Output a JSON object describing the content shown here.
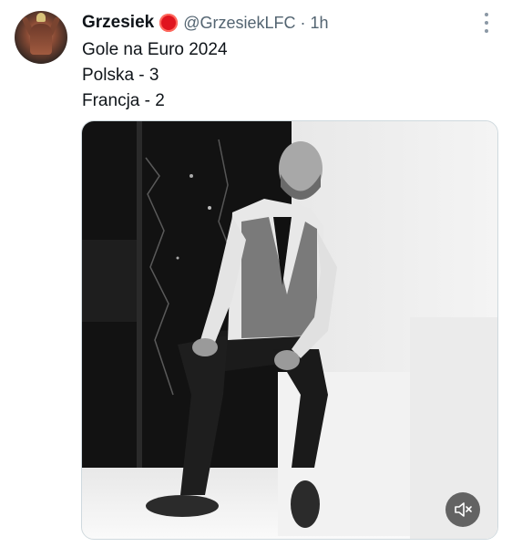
{
  "tweet": {
    "author": {
      "display_name": "Grzesiek",
      "badge_icon": "red-circle-emoji",
      "badge_color": "#e0141e",
      "handle": "@GrzesiekLFC",
      "separator": "·",
      "time": "1h"
    },
    "text_lines": [
      "Gole na Euro 2024",
      "Polska - 3",
      "Francja - 2"
    ],
    "media": {
      "type": "video",
      "colors": "black-and-white",
      "mute_icon": "speaker-muted-icon"
    },
    "more_icon": "more-options-icon"
  }
}
